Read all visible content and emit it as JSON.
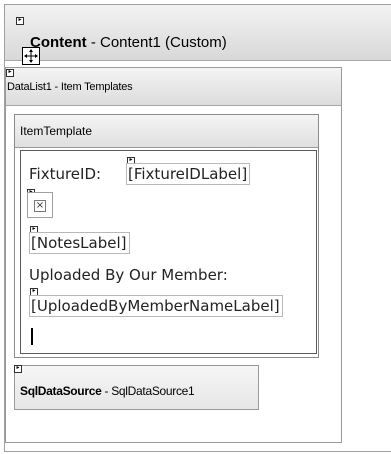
{
  "content_control": {
    "id_label": "Content",
    "description": " - Content1 (Custom)"
  },
  "datalist": {
    "title": "DataList1 - Item Templates",
    "template_name": "ItemTemplate"
  },
  "template_body": {
    "fixture_label": "FixtureID: ",
    "fixture_control": "[FixtureIDLabel]",
    "image_placeholder_glyph": "×",
    "notes_control": "[NotesLabel]",
    "uploaded_text": "Uploaded By Our Member:",
    "uploaded_control": "[UploadedByMemberNameLabel]"
  },
  "sqldatasource": {
    "type_label": "SqlDataSource",
    "description": " - SqlDataSource1"
  },
  "icons": {
    "smart_tag": "smart-tag-arrow-icon",
    "move": "move-handle-icon",
    "broken_image": "broken-image-icon"
  }
}
